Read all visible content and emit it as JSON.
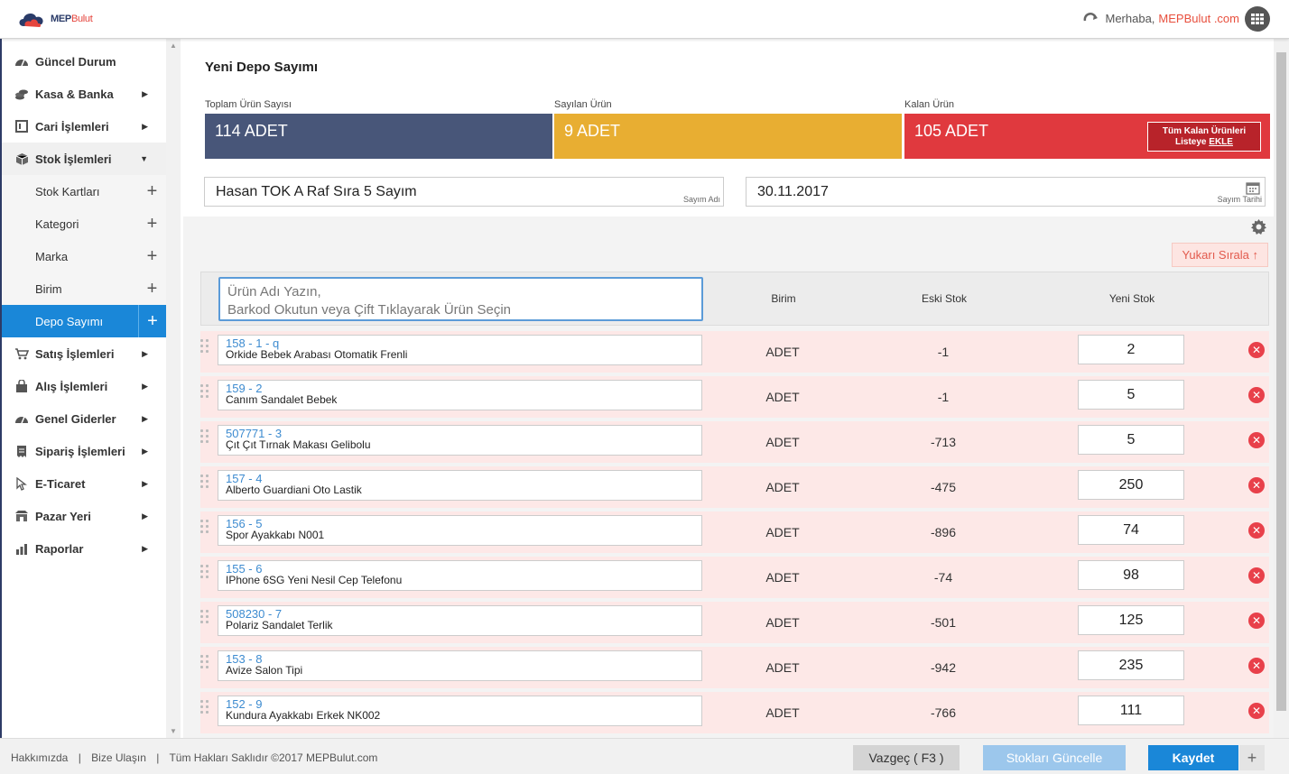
{
  "brand": {
    "name_a": "MEP",
    "name_b": "Bulut"
  },
  "header": {
    "greeting": "Merhaba,",
    "user": "MEPBulut .com"
  },
  "sidebar": {
    "items": [
      {
        "label": "Güncel Durum",
        "icon": "gauge-icon",
        "arrow": ""
      },
      {
        "label": "Kasa & Banka",
        "icon": "coins-icon",
        "arrow": "▶"
      },
      {
        "label": "Cari İşlemleri",
        "icon": "ledger-icon",
        "arrow": "▶"
      },
      {
        "label": "Stok İşlemleri",
        "icon": "box-icon",
        "arrow": "▼"
      }
    ],
    "sub_items": [
      {
        "label": "Stok Kartları"
      },
      {
        "label": "Kategori"
      },
      {
        "label": "Marka"
      },
      {
        "label": "Birim"
      },
      {
        "label": "Depo Sayımı"
      }
    ],
    "items_after": [
      {
        "label": "Satış İşlemleri",
        "icon": "cart-icon",
        "arrow": "▶"
      },
      {
        "label": "Alış İşlemleri",
        "icon": "bag-icon",
        "arrow": "▶"
      },
      {
        "label": "Genel Giderler",
        "icon": "gauge-icon",
        "arrow": "▶"
      },
      {
        "label": "Sipariş İşlemleri",
        "icon": "receipt-icon",
        "arrow": "▶"
      },
      {
        "label": "E-Ticaret",
        "icon": "pointer-icon",
        "arrow": "▶"
      },
      {
        "label": "Pazar Yeri",
        "icon": "market-icon",
        "arrow": "▶"
      },
      {
        "label": "Raporlar",
        "icon": "bar-chart-icon",
        "arrow": "▶"
      }
    ]
  },
  "page": {
    "title": "Yeni Depo Sayımı",
    "stats": {
      "total_label": "Toplam Ürün Sayısı",
      "total_value": "114 ADET",
      "counted_label": "Sayılan Ürün",
      "counted_value": "9 ADET",
      "remaining_label": "Kalan Ürün",
      "remaining_value": "105 ADET",
      "add_line1": "Tüm Kalan Ürünleri",
      "add_line2a": "Listeye ",
      "add_line2b": "EKLE"
    },
    "count_name": {
      "value": "Hasan TOK A Raf Sıra 5 Sayım",
      "caption": "Sayım Adı"
    },
    "count_date": {
      "value": "30.11.2017",
      "caption": "Sayım Tarihi"
    },
    "sort_button": "Yukarı Sırala ↑",
    "search_placeholder_1": "Ürün Adı Yazın,",
    "search_placeholder_2": "Barkod Okutun veya Çift Tıklayarak Ürün Seçin",
    "columns": {
      "unit": "Birim",
      "old": "Eski Stok",
      "new": "Yeni Stok"
    }
  },
  "rows": [
    {
      "code": "158 - 1 - q",
      "name": "Orkide Bebek Arabası Otomatik Frenli",
      "unit": "ADET",
      "old": "-1",
      "new": "2"
    },
    {
      "code": "159 - 2",
      "name": "Canım Sandalet Bebek",
      "unit": "ADET",
      "old": "-1",
      "new": "5"
    },
    {
      "code": "507771 - 3",
      "name": "Çıt Çıt Tırnak Makası Gelibolu",
      "unit": "ADET",
      "old": "-713",
      "new": "5"
    },
    {
      "code": "157 - 4",
      "name": "Alberto Guardiani Oto Lastik",
      "unit": "ADET",
      "old": "-475",
      "new": "250"
    },
    {
      "code": "156 - 5",
      "name": "Spor Ayakkabı N001",
      "unit": "ADET",
      "old": "-896",
      "new": "74"
    },
    {
      "code": "155 - 6",
      "name": "IPhone 6SG Yeni Nesil Cep Telefonu",
      "unit": "ADET",
      "old": "-74",
      "new": "98"
    },
    {
      "code": "508230 - 7",
      "name": "Polariz Sandalet Terlik",
      "unit": "ADET",
      "old": "-501",
      "new": "125"
    },
    {
      "code": "153 - 8",
      "name": "Avize Salon Tipi",
      "unit": "ADET",
      "old": "-942",
      "new": "235"
    },
    {
      "code": "152 - 9",
      "name": "Kundura Ayakkabı Erkek NK002",
      "unit": "ADET",
      "old": "-766",
      "new": "111"
    }
  ],
  "footer": {
    "about": "Hakkımızda",
    "contact": "Bize Ulaşın",
    "rights": "Tüm Hakları Saklıdır ©2017 MEPBulut.com",
    "sep": "|",
    "cancel": "Vazgeç ( F3 )",
    "update": "Stokları Güncelle",
    "save": "Kaydet",
    "more": "+"
  },
  "colors": {
    "navy": "#485679",
    "amber": "#e8ae32",
    "red": "#e0393e",
    "blue": "#1a87d8",
    "row_bg": "#fde8e7"
  }
}
